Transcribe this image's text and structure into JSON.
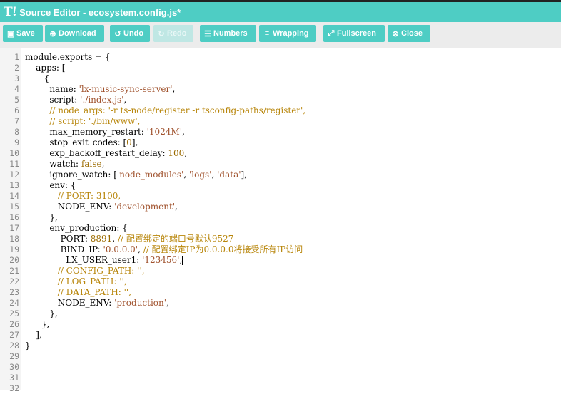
{
  "window": {
    "logo": "T!",
    "title": "Source Editor - ecosystem.config.js*"
  },
  "toolbar": {
    "save": "Save",
    "download": "Download",
    "undo": "Undo",
    "redo": "Redo",
    "numbers": "Numbers",
    "wrapping": "Wrapping",
    "fullscreen": "Fullscreen",
    "close": "Close"
  },
  "editor": {
    "lines": [
      "module.exports = {",
      "    apps: [",
      "       {",
      "         name: 'lx-music-sync-server',",
      "         script: './index.js',",
      "         // node_args: '-r ts-node/register -r tsconfig-paths/register',",
      "         // script: './bin/www',",
      "         max_memory_restart: '1024M',",
      "         stop_exit_codes: [0],",
      "         exp_backoff_restart_delay: 100,",
      "         watch: false,",
      "         ignore_watch: ['node_modules', 'logs', 'data'],",
      "         env: {",
      "            // PORT: 3100,",
      "            NODE_ENV: 'development',",
      "         },",
      "         env_production: {",
      "             PORT: 8891, // 配置绑定的端口号默认9527",
      "             BIND_IP: '0.0.0.0', // 配置绑定IP为0.0.0.0将接受所有IP访问",
      "               LX_USER_user1: '123456',",
      "            // CONFIG_PATH: '',",
      "            // LOG_PATH: '',",
      "            // DATA_PATH: '',",
      "            NODE_ENV: 'production',",
      "         },",
      "      },",
      "    ],",
      "}",
      "",
      "",
      "",
      ""
    ]
  },
  "colors": {
    "accent": "#4ecdc4",
    "string": "#a0522d",
    "comment": "#b8860b",
    "number": "#9c6b00"
  }
}
